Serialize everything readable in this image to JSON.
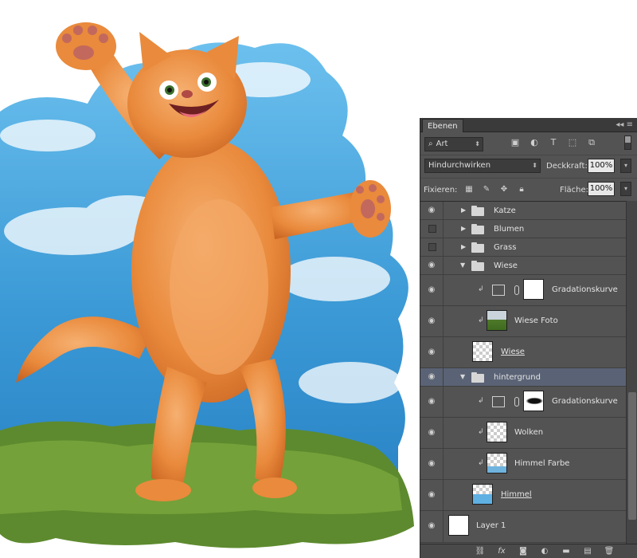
{
  "panel": {
    "tab_label": "Ebenen",
    "menu_icon": "panel-menu-icon",
    "filter_value": "Art",
    "blend_mode": "Hindurchwirken",
    "opacity_label": "Deckkraft:",
    "opacity_value": "100%",
    "lock_label": "Fixieren:",
    "fill_label": "Fläche:",
    "fill_value": "100%"
  },
  "layers": [
    {
      "name": "Katze",
      "type": "group",
      "visible": true,
      "expanded": false
    },
    {
      "name": "Blumen",
      "type": "group",
      "visible": false,
      "expanded": false
    },
    {
      "name": "Grass",
      "type": "group",
      "visible": false,
      "expanded": false
    },
    {
      "name": "Wiese",
      "type": "group",
      "visible": true,
      "expanded": true
    },
    {
      "name": "Gradationskurve",
      "type": "adjustment",
      "visible": true,
      "clipped": true
    },
    {
      "name": "Wiese Foto",
      "type": "image",
      "visible": true,
      "clipped": true
    },
    {
      "name": "Wiese ",
      "type": "layer",
      "visible": true
    },
    {
      "name": "hintergrund",
      "type": "group",
      "visible": true,
      "expanded": true,
      "selected": true
    },
    {
      "name": "Gradationskurve",
      "type": "adjustment",
      "visible": true,
      "clipped": true
    },
    {
      "name": "Wolken",
      "type": "layer",
      "visible": true,
      "clipped": true
    },
    {
      "name": "Himmel Farbe",
      "type": "layer",
      "visible": true,
      "clipped": true
    },
    {
      "name": "Himmel ",
      "type": "layer",
      "visible": true
    },
    {
      "name": "Layer 1",
      "type": "layer",
      "visible": true
    }
  ],
  "colors": {
    "panel_bg": "#535353",
    "selected_row": "#5a6375",
    "sky": "#4aa3d8",
    "cat": "#e98a3c",
    "grass": "#5d8a2e"
  }
}
